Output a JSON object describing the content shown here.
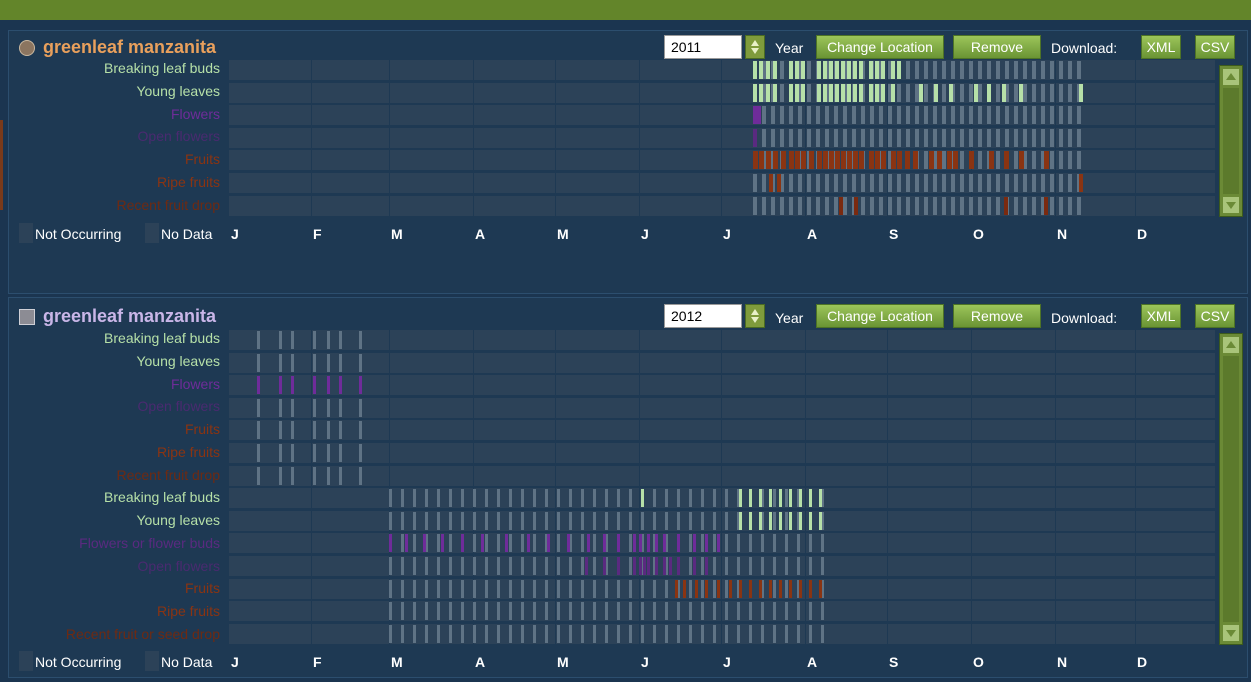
{
  "colors": {
    "topbar": "#63852a",
    "panel_bg": "#1e3953",
    "cell_bg": "#2c4258",
    "status_gray": "#5f7385",
    "leaf_green": "#b6e0a8",
    "flower_purple": "#6f2c9a",
    "fruit_red": "#8a3412",
    "button_green": "#7fa840",
    "header_orange": "#e9a05c"
  },
  "panels": [
    {
      "species": "greenleaf manzanita",
      "year": "2011",
      "year_label": "Year",
      "change_location": "Change Location",
      "remove": "Remove",
      "download_label": "Download:",
      "xml": "XML",
      "csv": "CSV",
      "phenophases": [
        {
          "label": "Breaking leaf buds",
          "color": "#b6e0a8"
        },
        {
          "label": "Young leaves",
          "color": "#b6e0a8"
        },
        {
          "label": "Flowers",
          "color": "#6f2c9a"
        },
        {
          "label": "Open flowers",
          "color": "#5a2a80"
        },
        {
          "label": "Fruits",
          "color": "#8a3412"
        },
        {
          "label": "Ripe fruits",
          "color": "#8a3412"
        },
        {
          "label": "Recent fruit drop",
          "color": "#7a2a10"
        }
      ],
      "legend": {
        "not_occurring": "Not Occurring",
        "no_data": "No Data"
      },
      "months": [
        "J",
        "F",
        "M",
        "A",
        "M",
        "J",
        "J",
        "A",
        "S",
        "O",
        "N",
        "D"
      ]
    },
    {
      "species": "greenleaf manzanita",
      "year": "2012",
      "year_label": "Year",
      "change_location": "Change Location",
      "remove": "Remove",
      "download_label": "Download:",
      "xml": "XML",
      "csv": "CSV",
      "phenophases": [
        {
          "label": "Breaking leaf buds",
          "color": "#b6e0a8"
        },
        {
          "label": "Young leaves",
          "color": "#b6e0a8"
        },
        {
          "label": "Flowers",
          "color": "#6f2c9a"
        },
        {
          "label": "Open flowers",
          "color": "#5a2a80"
        },
        {
          "label": "Fruits",
          "color": "#8a3412"
        },
        {
          "label": "Ripe fruits",
          "color": "#8a3412"
        },
        {
          "label": "Recent fruit drop",
          "color": "#7a2a10"
        },
        {
          "label": "Breaking leaf buds",
          "color": "#b6e0a8"
        },
        {
          "label": "Young leaves",
          "color": "#b6e0a8"
        },
        {
          "label": "Flowers or flower buds",
          "color": "#6f2c9a"
        },
        {
          "label": "Open flowers",
          "color": "#5a2a80"
        },
        {
          "label": "Fruits",
          "color": "#8a3412"
        },
        {
          "label": "Ripe fruits",
          "color": "#8a3412"
        },
        {
          "label": "Recent fruit or seed drop",
          "color": "#7a2a10"
        }
      ],
      "legend": {
        "not_occurring": "Not Occurring",
        "no_data": "No Data"
      },
      "months": [
        "J",
        "F",
        "M",
        "A",
        "M",
        "J",
        "J",
        "A",
        "S",
        "O",
        "N",
        "D"
      ]
    }
  ]
}
